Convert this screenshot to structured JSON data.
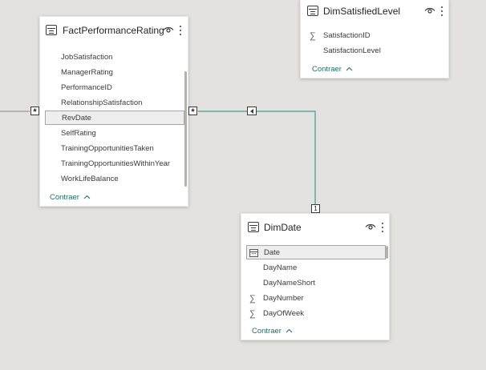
{
  "tables": {
    "fact": {
      "title": "FactPerformanceRating",
      "fields": [
        "JobSatisfaction",
        "ManagerRating",
        "PerformanceID",
        "RelationshipSatisfaction",
        "RevDate",
        "SelfRating",
        "TrainingOpportunitiesTaken",
        "TrainingOpportunitiesWithinYear",
        "WorkLifeBalance"
      ],
      "selected_field": "RevDate",
      "collapse_label": "Contraer"
    },
    "satisfied": {
      "title": "DimSatisfiedLevel",
      "fields": [
        "SatisfactionID",
        "SatisfactionLevel"
      ],
      "collapse_label": "Contraer"
    },
    "date": {
      "title": "DimDate",
      "fields": [
        "Date",
        "DayName",
        "DayNameShort",
        "DayNumber",
        "DayOfWeek"
      ],
      "selected_field": "Date",
      "collapse_label": "Contraer"
    }
  },
  "relationships": {
    "left_many": "*",
    "fact_many": "*",
    "date_one": "1"
  },
  "icons": {
    "table": "table-icon",
    "visibility": "eye-icon",
    "more": "more-options-icon",
    "sum": "sigma-icon",
    "date": "calendar-icon",
    "collapse": "chevron-up-icon",
    "cross_filter": "filter-direction-icon"
  },
  "colors": {
    "canvas": "#e3e2e1",
    "relationship_line": "#3e9b8c",
    "link": "#1e6f66"
  }
}
